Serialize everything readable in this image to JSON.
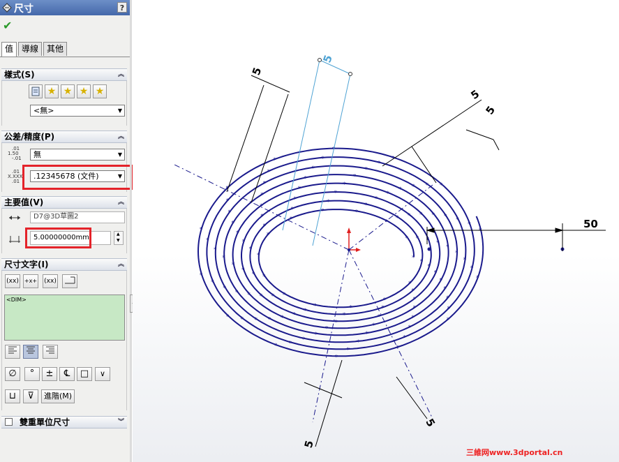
{
  "panel": {
    "title": "尺寸",
    "help": "?",
    "ok": "✔",
    "tabs": [
      "值",
      "導線",
      "其他"
    ],
    "style_section": {
      "label": "樣式(S)",
      "collapse": "︽",
      "dropdown_value": "<無>"
    },
    "tolerance_section": {
      "label": "公差/精度(P)",
      "collapse": "︽",
      "tolerance_icon_top": ".01",
      "tolerance_icon_mid": "1.50",
      "tolerance_icon_bottom": "-.01",
      "tolerance_value": "無",
      "precision_icon_top": ".01",
      "precision_icon_mid": "X.XXX",
      "precision_icon_bottom": ".01",
      "precision_value": ".12345678 (文件)"
    },
    "primary_section": {
      "label": "主要值(V)",
      "collapse": "︽",
      "reference": "D7@3D草圖2",
      "value": "5.00000000mm"
    },
    "dim_text_section": {
      "label": "尺寸文字(I)",
      "collapse": "︽",
      "btn_xx1": "(xx)",
      "btn_x": "+x+",
      "btn_xx2": "(xx)",
      "dim_text": "<DIM>",
      "btn_diameter": "∅",
      "btn_degree": "°",
      "btn_plusminus": "±",
      "btn_centerline": "℄",
      "btn_square": "□",
      "btn_more": "∨",
      "btn_cbore": "⊔",
      "btn_depth": "⊽",
      "advanced": "進階(M)"
    },
    "dual_section": {
      "label": "雙重單位尺寸",
      "collapse": "︾"
    }
  },
  "drawing": {
    "dim_labels": [
      "5",
      "5",
      "5",
      "5",
      "50",
      "5",
      "5"
    ],
    "selected_dim_label": "5",
    "line_color": "#1a1a8c",
    "selected_color": "#4fa3d4"
  },
  "watermark": "三維网www.3dportal.cn"
}
